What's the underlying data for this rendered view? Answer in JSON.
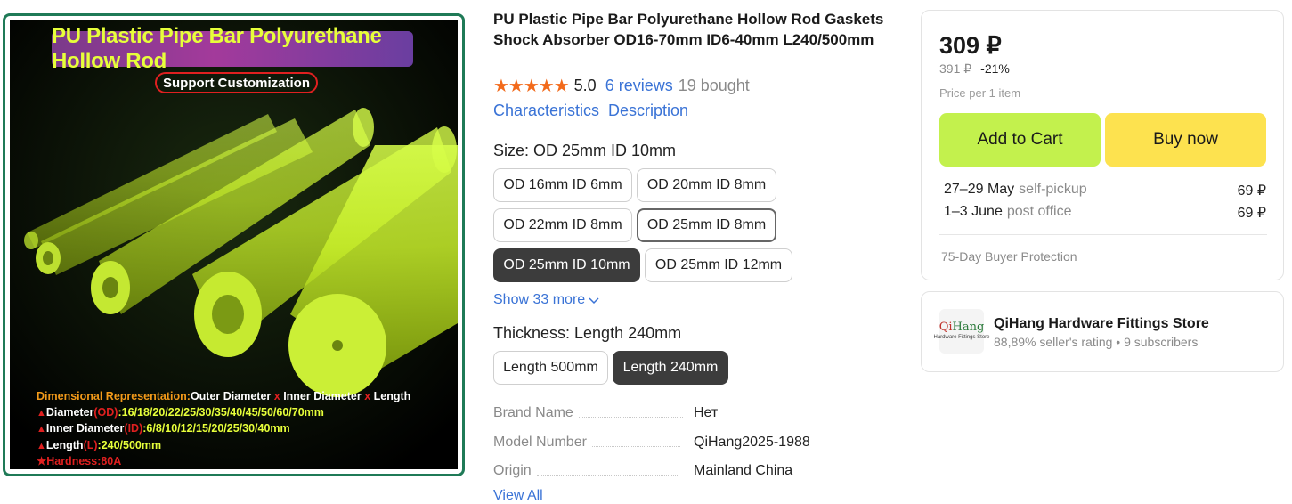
{
  "product_image": {
    "banner_title": "PU Plastic Pipe Bar Polyurethane Hollow Rod",
    "support_tag": "Support Customization",
    "dim_label": "Dimensional Representation:",
    "dim_outer": "Outer Diameter",
    "dim_x": "x",
    "dim_inner": "Inner Diameter",
    "dim_length": "Length",
    "line_od_label": "Diameter",
    "line_od_code": "(OD)",
    "line_od_values": ":16/18/20/22/25/30/35/40/45/50/60/70mm",
    "line_id_label": "Inner Diameter",
    "line_id_code": "(ID)",
    "line_id_values": ":6/8/10/12/15/20/25/30/40mm",
    "line_len_label": "Length",
    "line_len_code": "(L)",
    "line_len_values": ":240/500mm",
    "line_hard": "Hardness:80A"
  },
  "product": {
    "title": "PU Plastic Pipe Bar Polyurethane Hollow Rod Gaskets Shock Absorber OD16-70mm ID6-40mm L240/500mm",
    "stars": "★★★★★",
    "rating": "5.0",
    "reviews": "6 reviews",
    "bought": "19 bought",
    "tab_characteristics": "Characteristics",
    "tab_description": "Description"
  },
  "size": {
    "label": "Size: OD 25mm ID 10mm",
    "options": [
      "OD 16mm ID 6mm",
      "OD 20mm ID 8mm",
      "OD 22mm ID 8mm",
      "OD 25mm ID 8mm",
      "OD 25mm ID 10mm",
      "OD 25mm ID 12mm"
    ],
    "show_more": "Show 33 more"
  },
  "thickness": {
    "label": "Thickness: Length 240mm",
    "options": [
      "Length 500mm",
      "Length 240mm"
    ]
  },
  "specs": [
    {
      "key": "Brand Name",
      "value": "Нет"
    },
    {
      "key": "Model Number",
      "value": "QiHang2025-1988"
    },
    {
      "key": "Origin",
      "value": "Mainland China"
    }
  ],
  "view_all": "View All",
  "buybox": {
    "price": "309 ₽",
    "old_price": "391 ₽",
    "discount": "-21%",
    "per_item": "Price per 1 item",
    "add_to_cart": "Add to Cart",
    "buy_now": "Buy now",
    "shipping": [
      {
        "date": "27–29 May",
        "method": "self-pickup",
        "cost": "69 ₽"
      },
      {
        "date": "1–3 June",
        "method": "post office",
        "cost": "69 ₽"
      }
    ],
    "protection": "75-Day Buyer Protection"
  },
  "store": {
    "logo_text_a": "Qi",
    "logo_text_b": "Hang",
    "logo_sub": "Hardware Fittings Store",
    "name": "QiHang Hardware Fittings Store",
    "meta": "88,89% seller's rating • 9 subscribers"
  },
  "colors": {
    "accent_link": "#3a73d6",
    "star": "#f26a1b",
    "add_to_cart_bg": "#c3f14d",
    "buy_now_bg": "#fde24f",
    "selected_chip": "#3c3c3c",
    "gallery_border": "#1f7a57"
  }
}
